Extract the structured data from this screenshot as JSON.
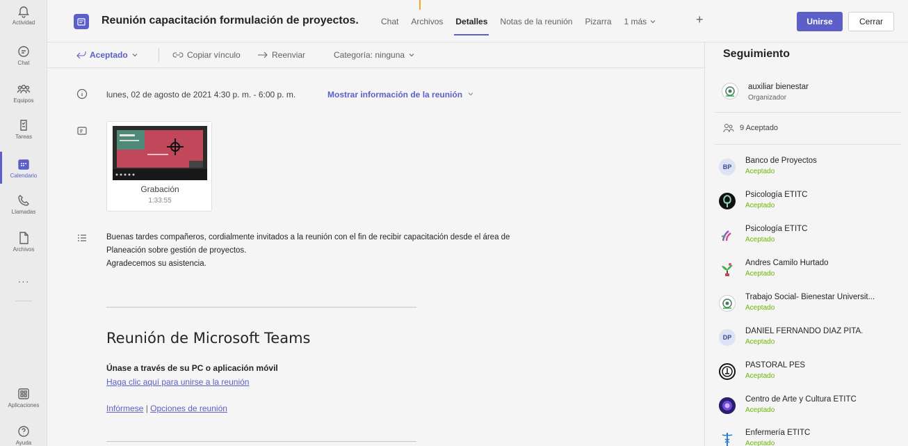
{
  "rail": {
    "items": [
      {
        "label": "Actividad",
        "icon": "bell-icon"
      },
      {
        "label": "Chat",
        "icon": "chat-icon"
      },
      {
        "label": "Equipos",
        "icon": "teams-icon"
      },
      {
        "label": "Tareas",
        "icon": "tasks-icon"
      },
      {
        "label": "Calendario",
        "icon": "calendar-icon",
        "active": true
      },
      {
        "label": "Llamadas",
        "icon": "phone-icon"
      },
      {
        "label": "Archivos",
        "icon": "file-icon"
      }
    ],
    "more": "···",
    "apps_label": "Aplicaciones",
    "help_label": "Ayuda"
  },
  "header": {
    "title": "Reunión capacitación formulación de proyectos.",
    "tabs": [
      "Chat",
      "Archivos",
      "Detalles",
      "Notas de la reunión",
      "Pizarra",
      "1 más"
    ],
    "active_tab": "Detalles",
    "join_label": "Unirse",
    "close_label": "Cerrar"
  },
  "toolbar": {
    "accepted": "Aceptado",
    "copy_link": "Copiar vínculo",
    "forward": "Reenviar",
    "category": "Categoría: ninguna"
  },
  "main": {
    "date": "lunes, 02 de agosto de 2021 4:30 p. m. - 6:00 p. m.",
    "show_info": "Mostrar información de la reunión",
    "recording": {
      "title": "Grabación",
      "duration": "1:33:55"
    },
    "description": [
      "Buenas tardes compañeros, cordialmente invitados a la reunión con el fin de recibir capacitación desde el área de",
      "Planeación sobre gestión de proyectos.",
      "Agradecemos su asistencia."
    ],
    "teams_heading": "Reunión de Microsoft Teams",
    "join_label": "Únase a través de su PC o aplicación móvil",
    "join_link": "Haga clic aquí para unirse a la reunión",
    "learn_more": "Infórmese",
    "separator": "|",
    "meeting_options": "Opciones de reunión"
  },
  "side": {
    "title": "Seguimiento",
    "organizer": {
      "name": "auxiliar bienestar",
      "role": "Organizador"
    },
    "accepted_count": "9 Aceptado",
    "attendees": [
      {
        "name": "Banco de Proyectos",
        "status": "Aceptado",
        "initials": "BP",
        "avatar_color": "#dce3f5",
        "text_color": "#3a4a8c"
      },
      {
        "name": "Psicología ETITC",
        "status": "Aceptado",
        "initials": "",
        "avatar_color": "#1a1a1a"
      },
      {
        "name": "Psicología ETITC",
        "status": "Aceptado",
        "initials": "",
        "avatar_color": "#f5f5f5"
      },
      {
        "name": "Andres Camilo Hurtado",
        "status": "Aceptado",
        "initials": "",
        "avatar_color": "#f5f5f5"
      },
      {
        "name": "Trabajo Social- Bienestar Universit...",
        "status": "Aceptado",
        "initials": "",
        "avatar_color": "#f5f5f5"
      },
      {
        "name": "DANIEL FERNANDO DIAZ PITA.",
        "status": "Aceptado",
        "initials": "DP",
        "avatar_color": "#dce3f5",
        "text_color": "#3a4a8c"
      },
      {
        "name": "PASTORAL PES",
        "status": "Aceptado",
        "initials": "",
        "avatar_color": "#ffffff"
      },
      {
        "name": "Centro de Arte y Cultura ETITC",
        "status": "Aceptado",
        "initials": "",
        "avatar_color": "#2a1f6e"
      },
      {
        "name": "Enfermería ETITC",
        "status": "Aceptado",
        "initials": "",
        "avatar_color": "#f5f5f5"
      }
    ]
  },
  "colors": {
    "accent": "#5b5fc7",
    "accepted_green": "#6bb700"
  }
}
